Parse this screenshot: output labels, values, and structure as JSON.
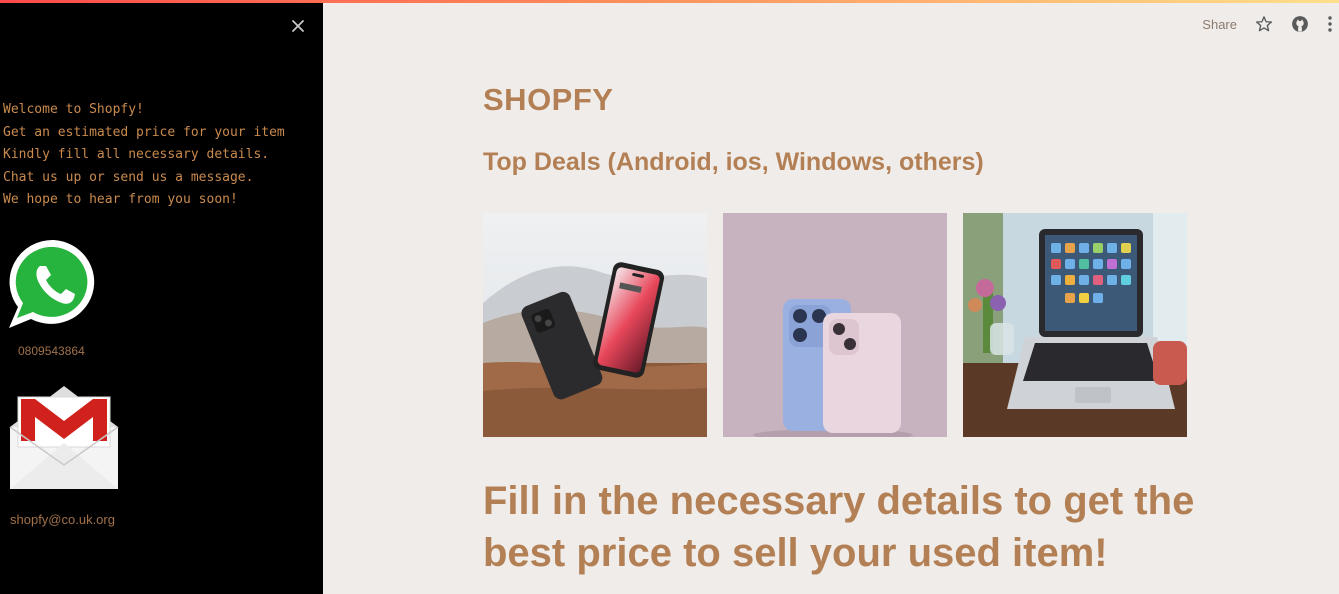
{
  "sidebar": {
    "lines": [
      "Welcome to Shopfy!",
      "Get an estimated price for your item",
      "Kindly fill all necessary details.",
      "Chat us up or send us a message.",
      "We hope to hear from you soon!"
    ],
    "phone": "0809543864",
    "email": "shopfy@co.uk.org"
  },
  "toolbar": {
    "share_label": "Share"
  },
  "main": {
    "title": "SHOPFY",
    "deals_heading": "Top Deals (Android, ios, Windows, others)",
    "deals_images": [
      "android-phones-image",
      "iphones-image",
      "laptop-image"
    ],
    "fill_heading": "Fill in the necessary details to get the best price to sell your used item!"
  },
  "colors": {
    "accent": "#b38055",
    "sidebar_text": "#c98a4e",
    "sidebar_bg": "#000000",
    "page_bg": "#f0ece9"
  }
}
